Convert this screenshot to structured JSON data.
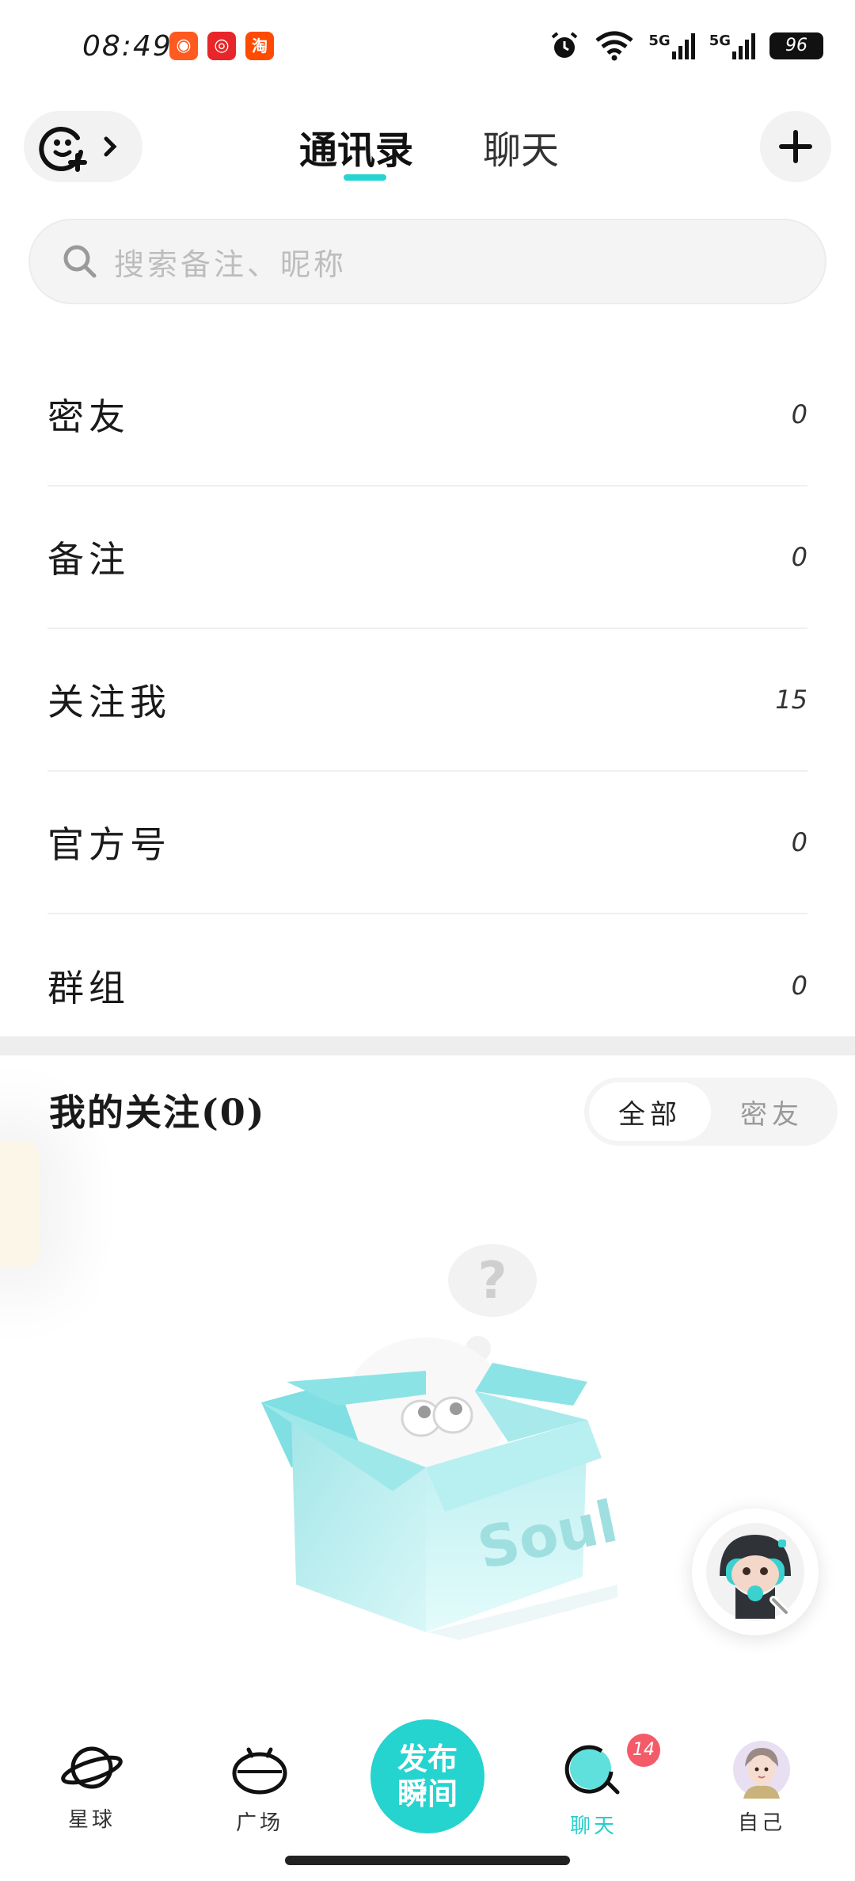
{
  "status_bar": {
    "time": "08:49",
    "battery": "96",
    "network_1": "5G",
    "network_2": "5G",
    "apps": [
      {
        "name": "kuaishou-icon",
        "color": "#ff5a1f",
        "glyph": "◉"
      },
      {
        "name": "netease-music-icon",
        "color": "#e8262a",
        "glyph": "◎"
      },
      {
        "name": "taobao-icon",
        "color": "#ff4a00",
        "glyph": "淘"
      }
    ]
  },
  "header": {
    "tabs": [
      {
        "label": "通讯录",
        "active": true
      },
      {
        "label": "聊天",
        "active": false
      }
    ]
  },
  "search": {
    "placeholder": "搜索备注、昵称"
  },
  "categories": [
    {
      "label": "密友",
      "count": "0"
    },
    {
      "label": "备注",
      "count": "0"
    },
    {
      "label": "关注我",
      "count": "15"
    },
    {
      "label": "官方号",
      "count": "0"
    },
    {
      "label": "群组",
      "count": "0"
    }
  ],
  "follows": {
    "title": "我的关注(0)",
    "filters": [
      {
        "label": "全部",
        "selected": true
      },
      {
        "label": "密友",
        "selected": false
      }
    ],
    "illustration_text": "Soul",
    "illustration_bubble": "?"
  },
  "bottom_nav": {
    "items": [
      {
        "label": "星球",
        "icon": "planet-icon",
        "active": false
      },
      {
        "label": "广场",
        "icon": "square-face-icon",
        "active": false
      },
      {
        "label": "聊天",
        "icon": "chat-bubble-icon",
        "active": true,
        "badge": "14"
      },
      {
        "label": "自己",
        "icon": "profile-avatar-icon",
        "active": false
      }
    ],
    "publish_line1": "发布",
    "publish_line2": "瞬间"
  },
  "colors": {
    "accent": "#25d3cf",
    "badge": "#f45b69"
  }
}
